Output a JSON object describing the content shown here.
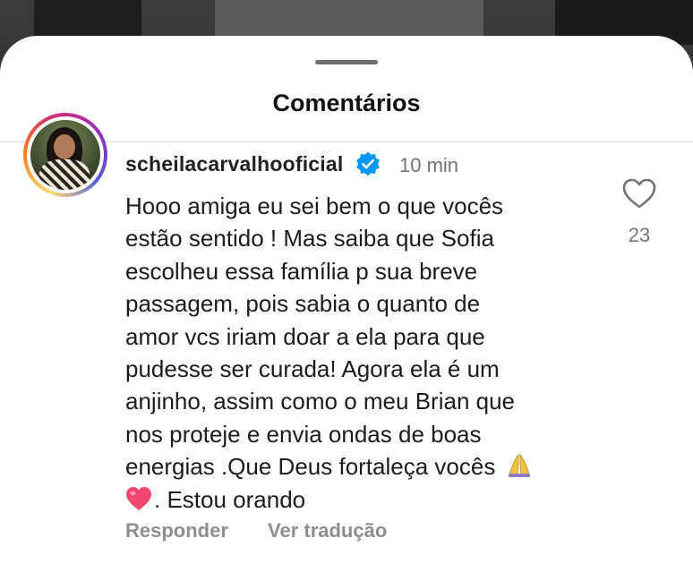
{
  "header": {
    "title": "Comentários"
  },
  "comment": {
    "username": "scheilacarvalhooficial",
    "verified": true,
    "timestamp": "10 min",
    "lines": [
      "Hooo amiga eu sei bem o que vocês",
      "estão sentido ! Mas saiba que Sofia",
      "escolheu  essa família p sua breve",
      "passagem, pois sabia o quanto de",
      "amor vcs iriam doar a ela para que",
      "pudesse ser curada! Agora ela é um",
      "anjinho, assim como o meu Brian  que",
      "nos proteje e envia ondas de boas",
      "energias .Que Deus fortaleça vocês"
    ],
    "last_line": ". Estou orando",
    "emojis": [
      "praying-hands",
      "pink-heart"
    ],
    "like_count": "23",
    "actions": {
      "reply": "Responder",
      "translate": "Ver tradução"
    }
  },
  "icons": {
    "verified_badge": "verified-badge-icon",
    "like": "heart-outline-icon"
  },
  "colors": {
    "verified_blue": "#0095f6",
    "text_primary": "#1c1c1c",
    "text_secondary": "#737373",
    "action_gray": "#8e8e8e",
    "divider": "#dbdbdb"
  }
}
